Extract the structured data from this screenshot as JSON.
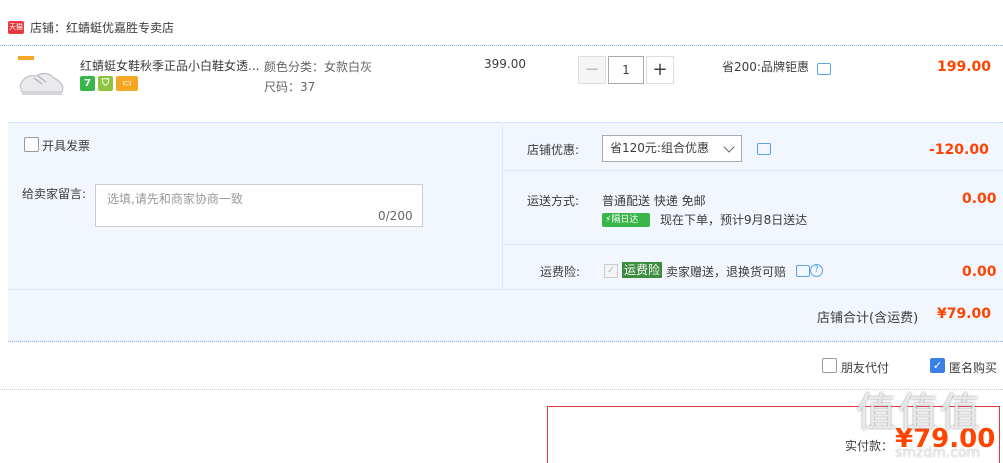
{
  "shop": {
    "badge": "天猫",
    "prefix": "店铺：",
    "name": "红蜻蜓优嘉胜专卖店"
  },
  "item": {
    "title": "红蜻蜓女鞋秋季正品小白鞋女透...",
    "color_label": "颜色分类：女款白灰",
    "size_label": "尺码：37",
    "badge_7": "7",
    "unit_price": "399.00",
    "quantity": "1",
    "minus": "−",
    "plus": "+",
    "promo": "省200:品牌钜惠",
    "total": "199.00"
  },
  "invoice": {
    "label": "开具发票"
  },
  "message": {
    "label": "给卖家留言:",
    "placeholder": "选填,请先和商家协商一致",
    "counter": "0/200"
  },
  "store_discount": {
    "label": "店铺优惠:",
    "selected": "省120元:组合优惠",
    "amount": "-120.00"
  },
  "shipping": {
    "label": "运送方式:",
    "method": "普通配送 快递 免邮",
    "next_day_tag": "隔日达",
    "eta": "现在下单，预计9月8日送达",
    "amount": "0.00"
  },
  "insurance": {
    "label": "运费险:",
    "tag": "运费险",
    "desc": "卖家赠送，退换货可赔",
    "amount": "0.00"
  },
  "store_total": {
    "label": "店铺合计(含运费)",
    "value": "¥79.00"
  },
  "options": {
    "friend_pay": "朋友代付",
    "anonymous": "匿名购买"
  },
  "payment": {
    "label": "实付款：",
    "value": "¥79.00"
  },
  "watermark": {
    "logo": "值值值",
    "url": "smzdm.com"
  },
  "colors": {
    "price_red": "#ff4400",
    "accent_blue": "#3a80e8",
    "panel_bg": "#f1f6ff"
  }
}
